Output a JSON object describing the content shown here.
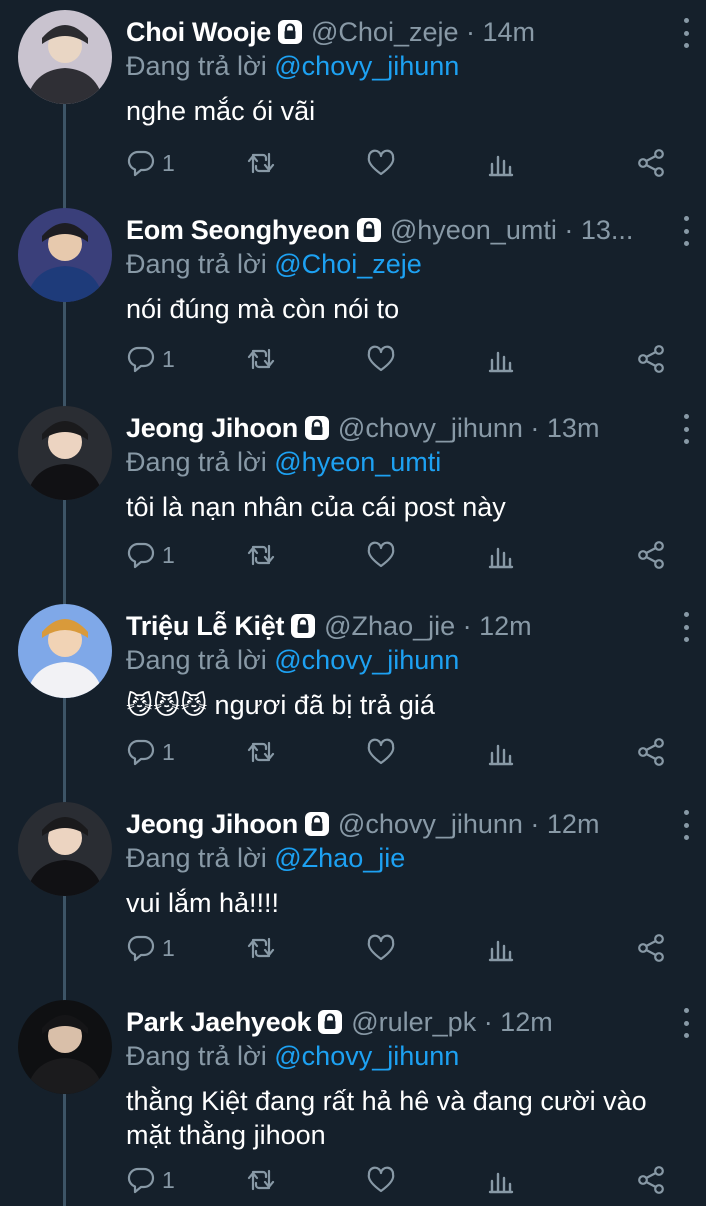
{
  "colors": {
    "background": "#15202b",
    "secondary_text": "#8899a6",
    "link": "#1da1f2",
    "thread_line": "#3d5466"
  },
  "icons": {
    "reply": "reply-icon",
    "retweet": "retweet-icon",
    "like": "heart-icon",
    "analytics": "analytics-icon",
    "share": "share-icon",
    "protected": "lock-icon",
    "more": "more-vertical-icon"
  },
  "tweets": [
    {
      "name": "Choi Wooje",
      "handle_time": "@Choi_zeje · 14m",
      "reply_prefix": "Đang trả lời ",
      "reply_to": "@chovy_jihunn",
      "text": "nghe mắc ói vãi",
      "reply_count": "1"
    },
    {
      "name": "Eom Seonghyeon",
      "handle_time": "@hyeon_umti · 13...",
      "reply_prefix": "Đang trả lời ",
      "reply_to": "@Choi_zeje",
      "text": "nói đúng mà còn nói to",
      "reply_count": "1"
    },
    {
      "name": "Jeong Jihoon",
      "handle_time": "@chovy_jihunn · 13m",
      "reply_prefix": "Đang trả lời ",
      "reply_to": "@hyeon_umti",
      "text": "tôi là nạn nhân của cái post này",
      "reply_count": "1"
    },
    {
      "name": "Triệu Lễ Kiệt",
      "handle_time": "@Zhao_jie · 12m",
      "reply_prefix": "Đang trả lời ",
      "reply_to": "@chovy_jihunn",
      "emoji": "😼😼😼",
      "text": "ngươi đã bị trả giá",
      "reply_count": "1"
    },
    {
      "name": "Jeong Jihoon",
      "handle_time": "@chovy_jihunn · 12m",
      "reply_prefix": "Đang trả lời ",
      "reply_to": "@Zhao_jie",
      "text": "vui lắm hả!!!!",
      "reply_count": "1"
    },
    {
      "name": "Park Jaehyeok",
      "handle_time": "@ruler_pk · 12m",
      "reply_prefix": "Đang trả lời ",
      "reply_to": "@chovy_jihunn",
      "text": "thằng Kiệt đang rất hả hê và đang cười vào mặt thằng jihoon",
      "reply_count": "1"
    }
  ]
}
